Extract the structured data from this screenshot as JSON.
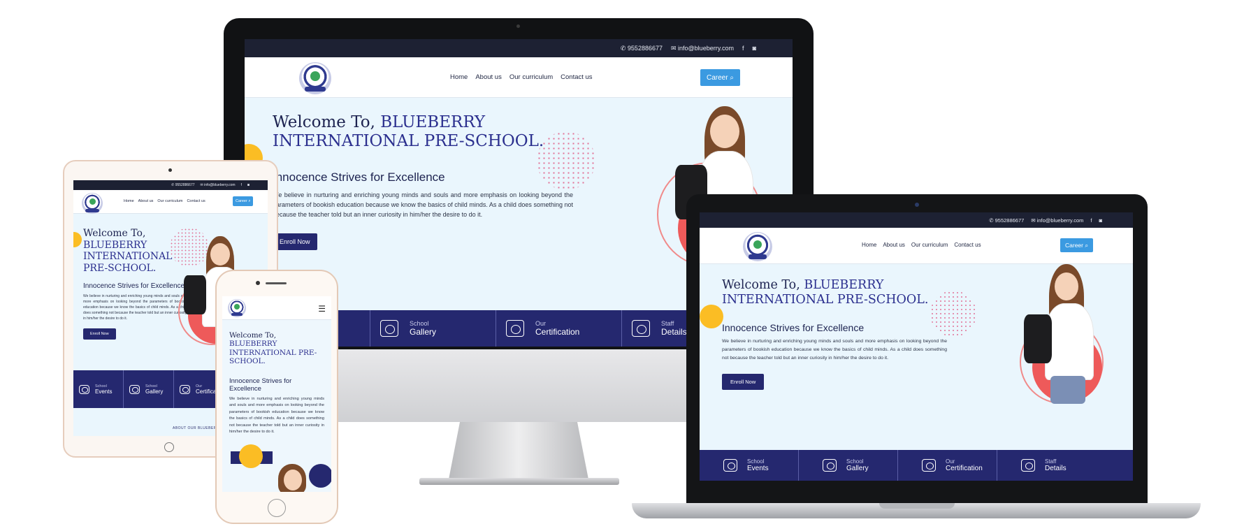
{
  "site": {
    "phone": "9552886677",
    "email": "info@blueberry.com",
    "nav": [
      "Home",
      "About us",
      "Our curriculum",
      "Contact us"
    ],
    "career": "Career",
    "welcome": "Welcome To,",
    "brand": "BLUEBERRY INTERNATIONAL PRE-SCHOOL.",
    "tagline": "Innocence Strives for Excellence",
    "body": "We believe in nurturing and enriching young minds and souls and more emphasis on looking beyond the parameters of bookish education because we know the basics of child minds. As a child does something not because the teacher told but an inner curiosity in him/her the desire to do it.",
    "enroll": "Enroll Now",
    "about_label": "ABOUT OUR BLUEBERRY"
  },
  "features": [
    {
      "small": "School",
      "big": "Events",
      "icon": "events-icon"
    },
    {
      "small": "School",
      "big": "Gallery",
      "icon": "gallery-icon"
    },
    {
      "small": "Our",
      "big": "Certification",
      "icon": "certification-icon"
    },
    {
      "small": "Staff",
      "big": "Details",
      "icon": "staff-icon"
    }
  ],
  "icons": {
    "phone": "phone-icon",
    "email": "mail-icon",
    "facebook": "facebook-icon",
    "instagram": "instagram-icon",
    "menu": "hamburger-menu-icon"
  },
  "colors": {
    "topbar": "#1d2133",
    "accent": "#3b9ae1",
    "navy": "#25286f",
    "hero_bg": "#eaf6fd",
    "yellow": "#fbbd24",
    "coral": "#ee5a5a"
  }
}
